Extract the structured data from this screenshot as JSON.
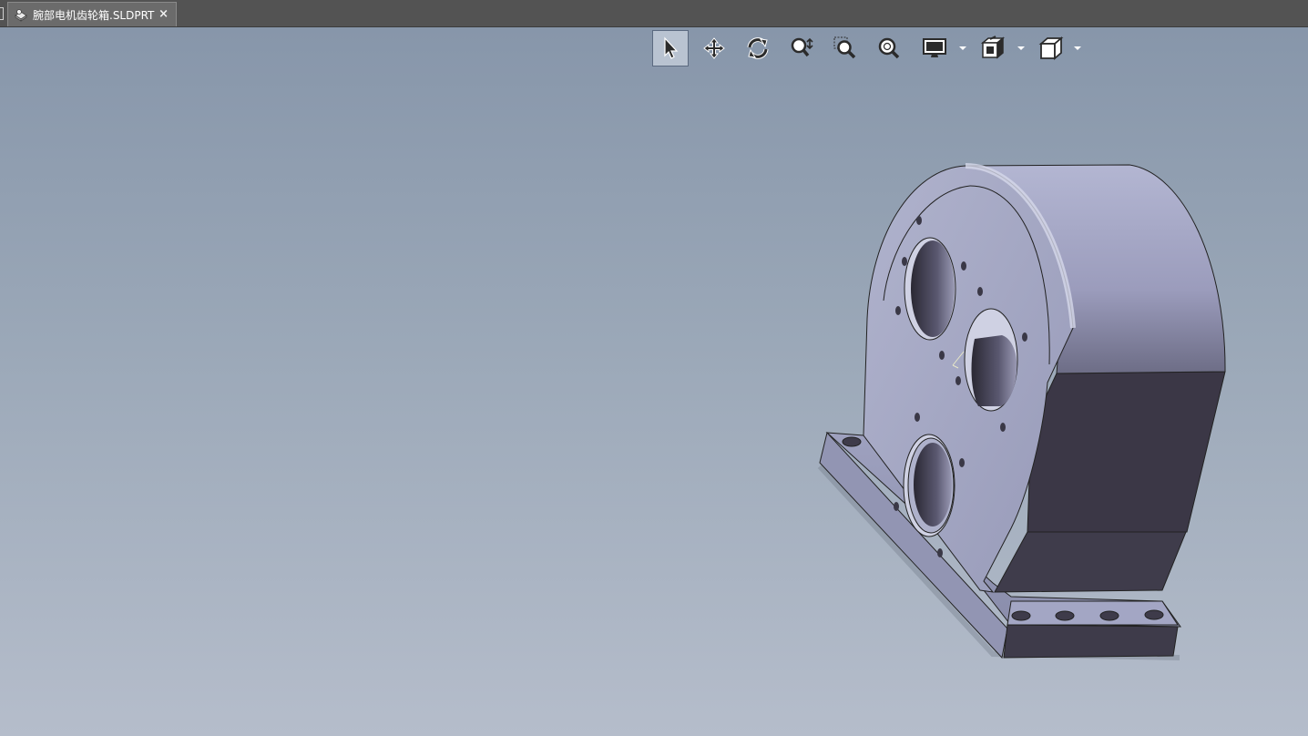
{
  "document_tab": {
    "title": "腕部电机齿轮箱.SLDPRT",
    "close_glyph": "×"
  },
  "heads_up_toolbar": {
    "tools": [
      {
        "name": "select",
        "icon": "cursor-icon",
        "active": true
      },
      {
        "name": "pan",
        "icon": "move-arrows-icon"
      },
      {
        "name": "rotate",
        "icon": "rotate-icon"
      },
      {
        "name": "zoom-in-out",
        "icon": "zoom-in-out-icon"
      },
      {
        "name": "zoom-to-area",
        "icon": "zoom-area-icon"
      },
      {
        "name": "zoom-to-fit",
        "icon": "zoom-fit-icon"
      },
      {
        "name": "display-style",
        "icon": "monitor-icon",
        "dropdown": true
      },
      {
        "name": "section-view",
        "icon": "section-view-icon",
        "dropdown": true
      },
      {
        "name": "view-orientation",
        "icon": "cube-icon",
        "dropdown": true
      }
    ]
  },
  "colors": {
    "tabbar_bg": "#535353",
    "viewport_top": "#8796aa",
    "viewport_bottom": "#b5bdcb",
    "part_light": "#a7abcb",
    "part_shadow": "#3c3847"
  }
}
